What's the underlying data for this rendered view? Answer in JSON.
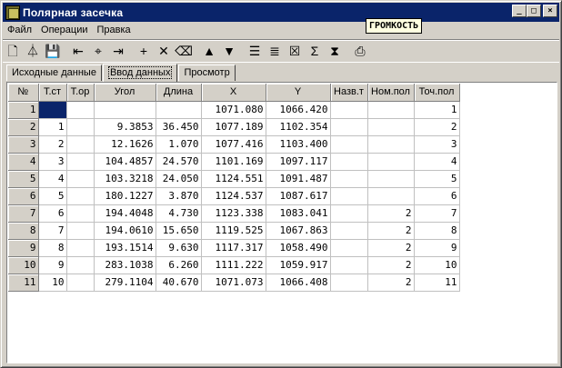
{
  "window": {
    "title": "Полярная засечка",
    "minimize": "_",
    "maximize": "□",
    "close": "×"
  },
  "menu": {
    "items": [
      "Файл",
      "Операции",
      "Правка"
    ]
  },
  "tooltip": "ГРОМКОСТЬ",
  "toolbar": {
    "buttons": [
      {
        "name": "new-document-icon",
        "glyph": "🗋"
      },
      {
        "name": "survey-station-icon",
        "glyph": "⏃"
      },
      {
        "name": "save-icon",
        "glyph": "💾"
      },
      {
        "name": "import-point-icon",
        "glyph": "⇤"
      },
      {
        "name": "target-icon",
        "glyph": "⌖"
      },
      {
        "name": "export-point-icon",
        "glyph": "⇥"
      },
      {
        "name": "add-row-icon",
        "glyph": "+"
      },
      {
        "name": "delete-row-icon",
        "glyph": "✕"
      },
      {
        "name": "eraser-icon",
        "glyph": "⌫"
      },
      {
        "name": "move-up-icon",
        "glyph": "▲"
      },
      {
        "name": "move-down-icon",
        "glyph": "▼"
      },
      {
        "name": "numbering-icon",
        "glyph": "☰"
      },
      {
        "name": "list-numbered-icon",
        "glyph": "≣"
      },
      {
        "name": "delete-list-icon",
        "glyph": "☒"
      },
      {
        "name": "sum-icon",
        "glyph": "Σ"
      },
      {
        "name": "mirror-icon",
        "glyph": "⧗"
      },
      {
        "name": "print-icon",
        "glyph": "⎙"
      }
    ]
  },
  "tabs": [
    "Исходные данные",
    "Ввод данных",
    "Просмотр"
  ],
  "table": {
    "headers": [
      "№",
      "Т.ст",
      "Т.ор",
      "Угол",
      "Длина",
      "X",
      "Y",
      "Назв.т",
      "Ном.пол",
      "Точ.пол"
    ],
    "rows": [
      [
        "1",
        "",
        "",
        "",
        "",
        "1071.080",
        "1066.420",
        "",
        "",
        "1"
      ],
      [
        "2",
        "1",
        "",
        "9.3853",
        "36.450",
        "1077.189",
        "1102.354",
        "",
        "",
        "2"
      ],
      [
        "3",
        "2",
        "",
        "12.1626",
        "1.070",
        "1077.416",
        "1103.400",
        "",
        "",
        "3"
      ],
      [
        "4",
        "3",
        "",
        "104.4857",
        "24.570",
        "1101.169",
        "1097.117",
        "",
        "",
        "4"
      ],
      [
        "5",
        "4",
        "",
        "103.3218",
        "24.050",
        "1124.551",
        "1091.487",
        "",
        "",
        "5"
      ],
      [
        "6",
        "5",
        "",
        "180.1227",
        "3.870",
        "1124.537",
        "1087.617",
        "",
        "",
        "6"
      ],
      [
        "7",
        "6",
        "",
        "194.4048",
        "4.730",
        "1123.338",
        "1083.041",
        "",
        "2",
        "7"
      ],
      [
        "8",
        "7",
        "",
        "194.0610",
        "15.650",
        "1119.525",
        "1067.863",
        "",
        "2",
        "8"
      ],
      [
        "9",
        "8",
        "",
        "193.1514",
        "9.630",
        "1117.317",
        "1058.490",
        "",
        "2",
        "9"
      ],
      [
        "10",
        "9",
        "",
        "283.1038",
        "6.260",
        "1111.222",
        "1059.917",
        "",
        "2",
        "10"
      ],
      [
        "11",
        "10",
        "",
        "279.1104",
        "40.670",
        "1071.073",
        "1066.408",
        "",
        "2",
        "11"
      ]
    ]
  }
}
